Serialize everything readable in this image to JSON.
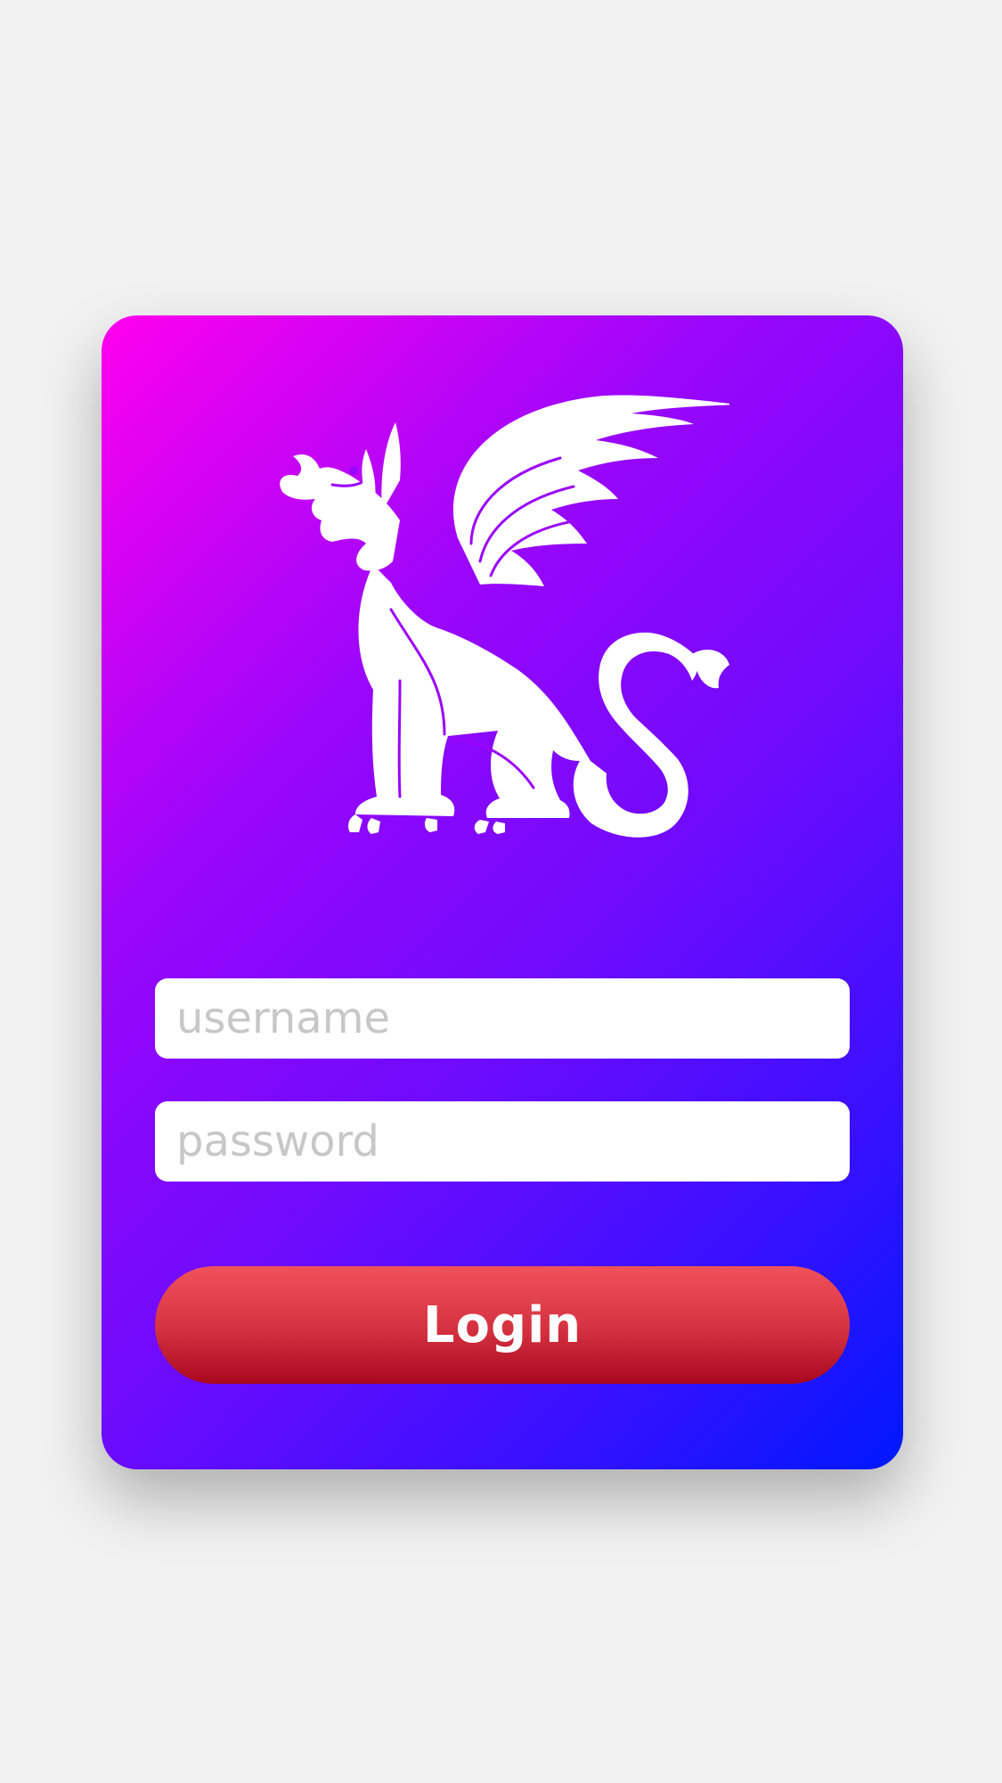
{
  "login_card": {
    "gradient_start": "#ff00ee",
    "gradient_end": "#0018ff",
    "logo_icon": "winged-dragon-icon",
    "username": {
      "placeholder": "username",
      "value": ""
    },
    "password": {
      "placeholder": "password",
      "value": ""
    },
    "login_label": "Login",
    "login_color": "#d43140"
  }
}
